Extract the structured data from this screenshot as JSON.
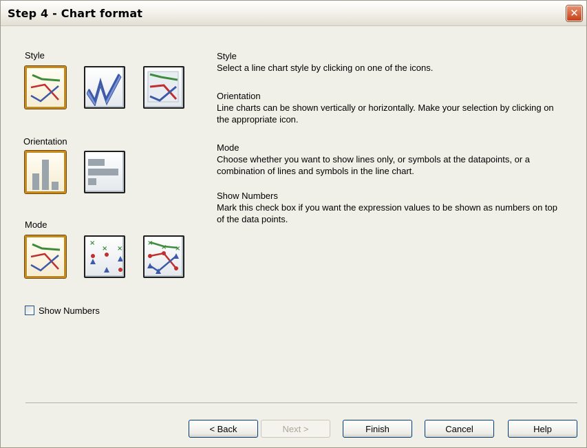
{
  "window": {
    "title": "Step 4 - Chart format",
    "close_glyph": "✕"
  },
  "left": {
    "style_label": "Style",
    "orientation_label": "Orientation",
    "mode_label": "Mode",
    "show_numbers_label": "Show Numbers",
    "show_numbers_checked": false,
    "style_icons": [
      "style-line-flat",
      "style-line-3d-ribbon",
      "style-line-3d-box"
    ],
    "style_selected": 0,
    "orientation_icons": [
      "orientation-vertical",
      "orientation-horizontal"
    ],
    "orientation_selected": 0,
    "mode_icons": [
      "mode-lines",
      "mode-symbols",
      "mode-lines-and-symbols"
    ],
    "mode_selected": 0
  },
  "help": {
    "style_title": "Style",
    "style_text": "Select a line chart style by clicking on one of the icons.",
    "orientation_title": "Orientation",
    "orientation_text": "Line charts can be shown vertically or horizontally. Make your selection by clicking on the appropriate icon.",
    "mode_title": "Mode",
    "mode_text": "Choose whether you want to show lines only, or symbols at the datapoints, or a combination of lines and symbols in the line chart.",
    "numbers_title": "Show Numbers",
    "numbers_text": "Mark this check box if you want the expression values to be shown as numbers on top of the data points."
  },
  "buttons": {
    "back": "< Back",
    "next": "Next >",
    "finish": "Finish",
    "cancel": "Cancel",
    "help": "Help"
  },
  "colors": {
    "accent_selected": "#c98a1a",
    "line_green": "#3c8c3c",
    "line_red": "#c03030",
    "line_blue": "#3c5aa8"
  }
}
